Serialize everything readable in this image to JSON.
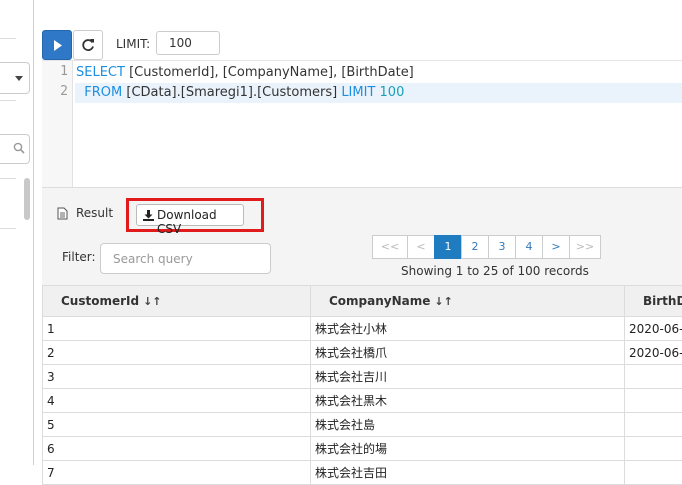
{
  "toolbar": {
    "limit_label": "LIMIT:",
    "limit_value": "100"
  },
  "editor": {
    "line_numbers": [
      "1",
      "2"
    ],
    "line1": {
      "kw_select": "SELECT",
      "columns": " [CustomerId], [CompanyName], [BirthDate]"
    },
    "line2": {
      "indent": "  ",
      "kw_from": "FROM",
      "table": " [CData].[Smaregi1].[Customers] ",
      "kw_limit": "LIMIT",
      "space": " ",
      "limit_num": "100"
    }
  },
  "result": {
    "tab_label": "Result",
    "download_label": "Download CSV",
    "filter_label": "Filter:",
    "filter_placeholder": "Search query",
    "summary": "Showing 1 to 25 of 100 records",
    "highlight_color": "#e11b1b",
    "pager": {
      "first": "<<",
      "prev": "<",
      "pages": [
        "1",
        "2",
        "3",
        "4"
      ],
      "active_page": "1",
      "next": ">",
      "last": ">>"
    },
    "table": {
      "columns": [
        {
          "label": "CustomerId",
          "sort_icon": "↓↑"
        },
        {
          "label": "CompanyName",
          "sort_icon": "↓↑"
        },
        {
          "label": "BirthD"
        }
      ],
      "rows": [
        [
          "1",
          "株式会社小林",
          "2020-06-0"
        ],
        [
          "2",
          "株式会社橋爪",
          "2020-06-0"
        ],
        [
          "3",
          "株式会社吉川",
          ""
        ],
        [
          "4",
          "株式会社黒木",
          ""
        ],
        [
          "5",
          "株式会社島",
          ""
        ],
        [
          "6",
          "株式会社的場",
          ""
        ],
        [
          "7",
          "株式会社吉田",
          ""
        ]
      ]
    }
  }
}
